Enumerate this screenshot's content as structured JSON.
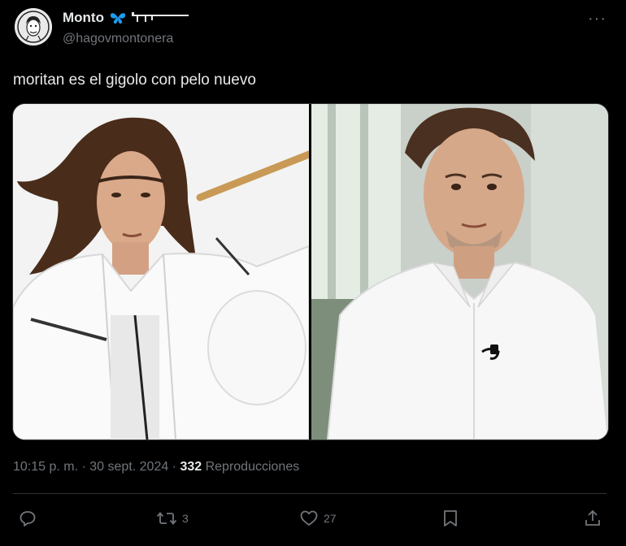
{
  "author": {
    "display_name": "Monto",
    "handle": "@hagovmontonera",
    "avatar_icon": "face-caricature-icon",
    "badges": [
      "butterfly-icon",
      "rifle-icon"
    ]
  },
  "tweet": {
    "text": "moritan es el gigolo con pelo nuevo",
    "images": [
      "man-long-hair-white-jacket-photo",
      "man-short-hair-white-shirt-photo"
    ]
  },
  "meta": {
    "time_date": "10:15 p. m. · 30 sept. 2024 · ",
    "views_count": "332",
    "views_label": " Reproducciones"
  },
  "actions": {
    "reply": {
      "icon": "reply-icon",
      "count": ""
    },
    "retweet": {
      "icon": "retweet-icon",
      "count": "3"
    },
    "like": {
      "icon": "heart-icon",
      "count": "27"
    },
    "bookmark": {
      "icon": "bookmark-icon"
    },
    "share": {
      "icon": "share-icon"
    }
  },
  "colors": {
    "background": "#000000",
    "text": "#e7e9ea",
    "muted": "#71767b",
    "border": "#2f3336",
    "badge": "#1d9bf0"
  }
}
